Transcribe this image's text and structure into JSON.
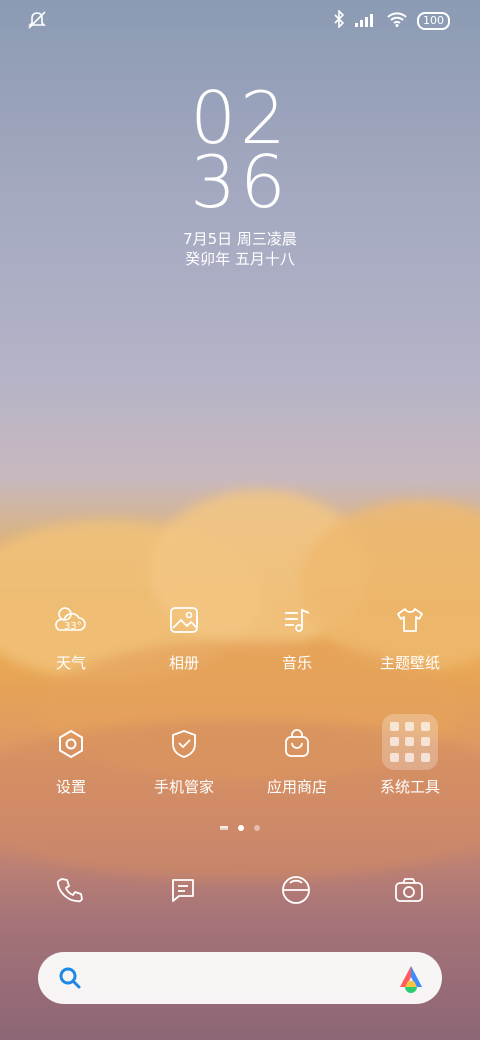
{
  "status_bar": {
    "left_icon": "notification-muted-icon",
    "right_icons": [
      "bluetooth-icon",
      "signal-icon",
      "wifi-icon"
    ],
    "battery": "100"
  },
  "clock": {
    "hour": "02",
    "minute": "36",
    "date_line": "7月5日 周三凌晨",
    "lunar_line": "癸卯年 五月十八"
  },
  "apps": {
    "weather": {
      "label": "天气",
      "temp": "33°"
    },
    "gallery": {
      "label": "相册"
    },
    "music": {
      "label": "音乐"
    },
    "themes": {
      "label": "主题壁纸"
    },
    "settings": {
      "label": "设置"
    },
    "security": {
      "label": "手机管家"
    },
    "store": {
      "label": "应用商店"
    },
    "tools": {
      "label": "系统工具"
    }
  },
  "page_indicator": {
    "pages": 2,
    "active": 1
  },
  "dock": [
    "phone-icon",
    "messages-icon",
    "browser-icon",
    "camera-icon"
  ],
  "search_bar": {
    "left_icon": "search-icon",
    "right_icon": "app-vault-logo-icon"
  },
  "colors": {
    "text": "#ffffff",
    "search_icon": "#1e88e5"
  }
}
